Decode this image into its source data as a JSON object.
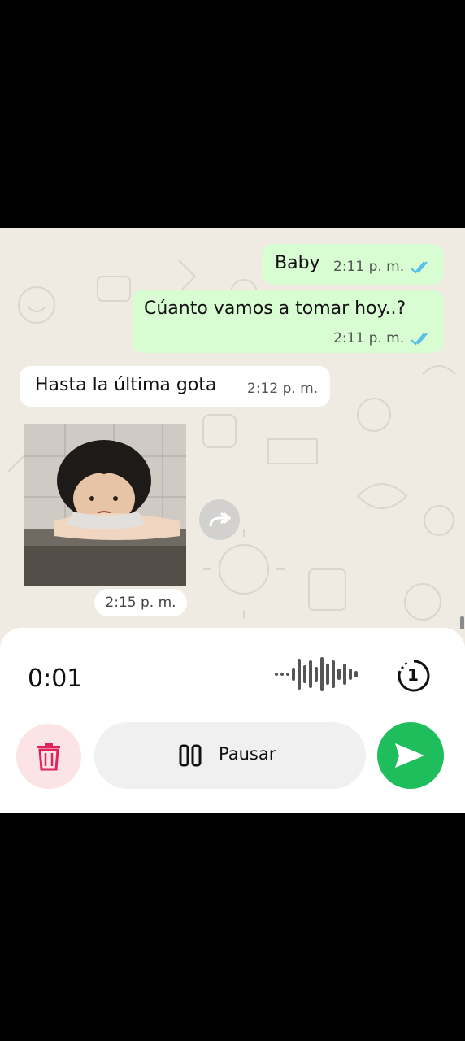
{
  "messages": [
    {
      "direction": "outgoing",
      "text": "Baby",
      "time": "2:11 p. m.",
      "status": "read-double-check"
    },
    {
      "direction": "outgoing",
      "text": "Cúanto vamos a tomar hoy..?",
      "time": "2:11 p. m.",
      "status": "read-double-check"
    },
    {
      "direction": "incoming",
      "text": "Hasta la última gota",
      "time": "2:12 p. m."
    },
    {
      "direction": "outgoing",
      "type": "sticker",
      "sticker_icon": "crying-child-sticker",
      "time": "2:15 p. m."
    }
  ],
  "forward_icon": "forward-icon",
  "recorder": {
    "duration": "0:01",
    "waveform_icon": "waveform-icon",
    "view_once_icon": "view-once-icon",
    "view_once_label": "1",
    "delete_icon": "trash-icon",
    "pause_icon": "pause-icon",
    "pause_label": "Pausar",
    "send_icon": "send-icon"
  },
  "colors": {
    "outgoing_bubble": "#d9fdd3",
    "incoming_bubble": "#ffffff",
    "chat_background": "#efeae2",
    "read_ticks": "#53bdeb",
    "send_button": "#1ebe5d",
    "delete_button_bg": "#fbe3e6",
    "delete_icon": "#e0245e"
  }
}
